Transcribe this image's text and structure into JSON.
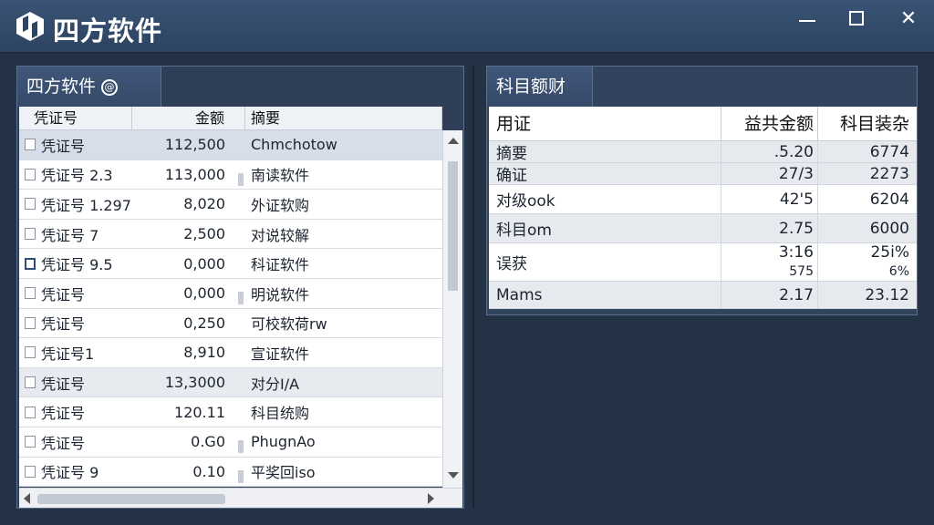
{
  "app": {
    "title": "四方软件"
  },
  "left_panel": {
    "tab_label": "四方软件",
    "tab_icon": "info-icon",
    "headers": [
      "凭证号",
      "金额",
      "摘要"
    ],
    "rows": [
      {
        "voucher": "凭证号",
        "amount": "112,500",
        "summary": "Chmchotow",
        "style": "sel"
      },
      {
        "voucher": "凭证号 2.3",
        "amount": "113,000",
        "summary": "南读软件",
        "style": ""
      },
      {
        "voucher": "凭证号 1.297",
        "amount": "8,020",
        "summary": "外证软购",
        "style": ""
      },
      {
        "voucher": "凭证号 7",
        "amount": "2,500",
        "summary": "对说较解",
        "style": ""
      },
      {
        "voucher": "凭证号 9.5",
        "amount": "0,000",
        "summary": "科证软件",
        "style": ""
      },
      {
        "voucher": "凭证号",
        "amount": "0,000",
        "summary": "明说软件",
        "style": ""
      },
      {
        "voucher": "凭证号",
        "amount": "0,250",
        "summary": "可校软荷rw",
        "style": ""
      },
      {
        "voucher": "凭证号1",
        "amount": "8,910",
        "summary": "宣证软件",
        "style": ""
      },
      {
        "voucher": "凭证号",
        "amount": "13,3000",
        "summary": "对分I/A",
        "style": "alt"
      },
      {
        "voucher": "凭证号",
        "amount": "120.11",
        "summary": "科目统购",
        "style": ""
      },
      {
        "voucher": "凭证号",
        "amount": "0.G0",
        "summary": "PhugnAo",
        "style": ""
      },
      {
        "voucher": "凭证号 9",
        "amount": "0.10",
        "summary": "平奖回iso",
        "style": ""
      }
    ]
  },
  "right_panel": {
    "tab_label": "科目额财",
    "headers": [
      "用证",
      "益共金额",
      "科目装杂"
    ],
    "rows": [
      {
        "name": "摘要",
        "v1": ".5.20",
        "v2": "6774",
        "style": "alt"
      },
      {
        "name": "确证",
        "v1": "27/3",
        "v2": "2273",
        "style": "alt"
      },
      {
        "name": "对级ook",
        "v1": "42'5",
        "v2": "6204",
        "style": ""
      },
      {
        "name": "科目om",
        "v1": "2.75",
        "v2": "6000",
        "style": "alt"
      },
      {
        "name": "误获",
        "v1": "3:16",
        "v1b": "575",
        "v2": "25i%",
        "v2b": "6%",
        "style": ""
      },
      {
        "name": "Mams",
        "v1": "2.17",
        "v2": "23.12",
        "style": "alt"
      }
    ]
  }
}
